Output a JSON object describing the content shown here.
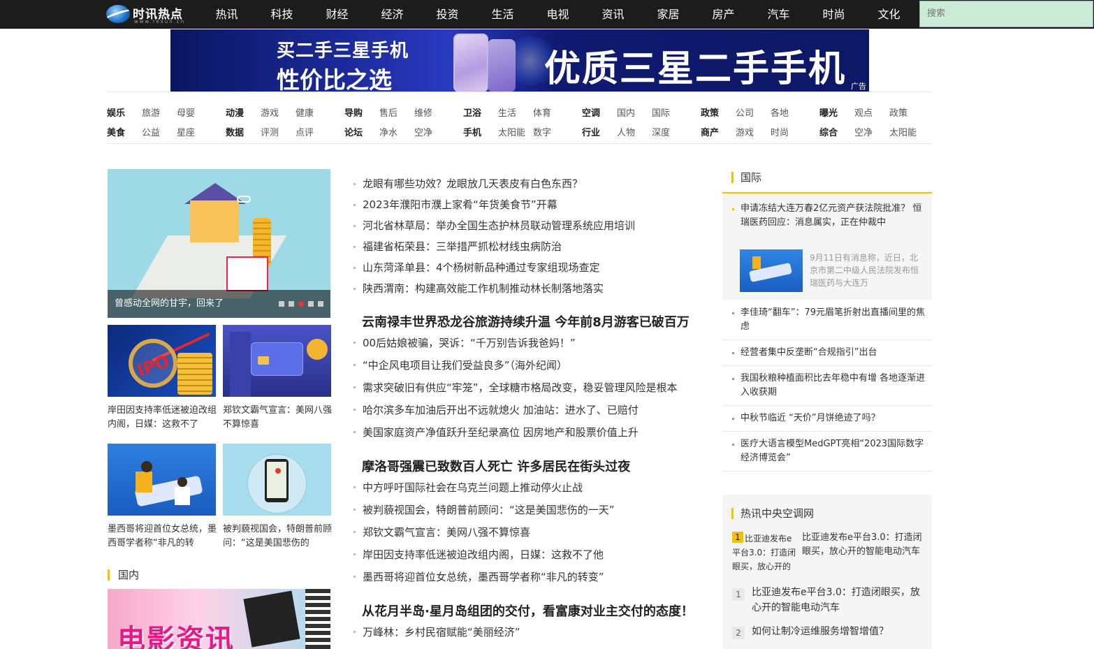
{
  "header": {
    "logo_text": "时讯热点",
    "logo_url_text": "www.rexun.cn",
    "nav": [
      "热讯",
      "科技",
      "财经",
      "经济",
      "投资",
      "生活",
      "电视",
      "资讯",
      "家居",
      "房产",
      "汽车",
      "时尚",
      "文化"
    ],
    "search_placeholder": "搜索"
  },
  "ad": {
    "line1": "买二手三星手机",
    "line2": "性价比之选",
    "headline": "优质三星二手手机",
    "tag": "广告"
  },
  "categories": [
    {
      "row1": [
        "娱乐",
        "旅游",
        "母婴"
      ],
      "row2": [
        "美食",
        "公益",
        "星座"
      ]
    },
    {
      "row1": [
        "动漫",
        "游戏",
        "健康"
      ],
      "row2": [
        "数据",
        "评测",
        "点评"
      ]
    },
    {
      "row1": [
        "导购",
        "售后",
        "维修"
      ],
      "row2": [
        "论坛",
        "净水",
        "空净"
      ]
    },
    {
      "row1": [
        "卫浴",
        "生活",
        "体育"
      ],
      "row2": [
        "手机",
        "太阳能",
        "数字"
      ]
    },
    {
      "row1": [
        "空调",
        "国内",
        "国际"
      ],
      "row2": [
        "行业",
        "人物",
        "深度"
      ]
    },
    {
      "row1": [
        "政策",
        "公司",
        "各地"
      ],
      "row2": [
        "商产",
        "游戏",
        "时尚"
      ]
    },
    {
      "row1": [
        "曝光",
        "观点",
        "政策"
      ],
      "row2": [
        "综合",
        "空净",
        "太阳能"
      ]
    }
  ],
  "left": {
    "slider_caption": "曾感动全网的甘宇，回来了",
    "thumbs": [
      {
        "caption": "岸田因支持率低迷被迫改组内阁，日媒：这救不了"
      },
      {
        "caption": "郑钦文霸气宣言：美网八强不算惊喜"
      },
      {
        "caption": "墨西哥将迎首位女总统，墨西哥学者称“非凡的转"
      },
      {
        "caption": "被判藐视国会，特朗普前顾问：“这是美国悲伤的"
      }
    ],
    "section_domestic": "国内",
    "movie_text": "电影资讯"
  },
  "center": {
    "list1": [
      "龙眼有哪些功效？龙眼放几天表皮有白色东西？",
      "2023年濮阳市濮上家肴“年货美食节”开幕",
      "河北省林草局：举办全国生态护林员联动管理系统应用培训",
      "福建省柘荣县：三举措严抓松材线虫病防治",
      "山东菏泽单县：4个杨树新品种通过专家组现场查定",
      "陕西渭南：构建高效能工作机制推动林长制落地落实"
    ],
    "headline2": "云南禄丰世界恐龙谷旅游持续升温 今年前8月游客已破百万",
    "list2": [
      "00后姑娘被骗，哭诉：“千万别告诉我爸妈！”",
      "“中企风电项目让我们受益良多”（海外纪闻）",
      "需求突破旧有供应“牢笼”，全球糖市格局改变，稳妥管理风险是根本",
      "哈尔滨多车加油后开出不远就熄火 加油站：进水了、已赔付",
      "美国家庭资产净值跃升至纪录高位 因房地产和股票价值上升"
    ],
    "headline3": "摩洛哥强震已致数百人死亡 许多居民在街头过夜",
    "list3": [
      "中方呼吁国际社会在乌克兰问题上推动停火止战",
      "被判藐视国会，特朗普前顾问：“这是美国悲伤的一天”",
      "郑钦文霸气宣言：美网八强不算惊喜",
      "岸田因支持率低迷被迫改组内阁，日媒：这救不了他",
      "墨西哥将迎首位女总统，墨西哥学者称“非凡的转变”"
    ],
    "headline4": "从花月半岛·星月岛组团的交付，看富康对业主交付的态度！",
    "list4": [
      "万峰林：乡村民宿赋能“美丽经济”"
    ]
  },
  "right": {
    "intl_title": "国际",
    "intl_first": "申请冻结大连万春2亿元资产获法院批准？ 恒瑞医药回应：消息属实，正在仲裁中",
    "intl_first_desc": "9月11日有消息称，近日，北京市第二中级人民法院发布恒瑞医药与大连万",
    "intl_items": [
      "李佳琦“翻车”：79元眉笔折射出直播间里的焦虑",
      "经营者集中反垄断“合规指引”出台",
      "我国秋粮种植面积比去年稳中有增 各地逐渐进入收获期",
      "中秋节临近 “天价”月饼绝迹了吗？",
      "医疗大语言模型MedGPT亮相“2023国际数字经济博览会”"
    ],
    "hot_title": "热讯中央空调网",
    "hot_first_rank": "1",
    "hot_first_small": "比亚迪发布e平台3.0：打造闭眼买，放心开的",
    "hot_first_title": "比亚迪发布e平台3.0：打造闭眼买，放心开的智能电动汽车",
    "hot_items": [
      {
        "rank": "1",
        "title": "比亚迪发布e平台3.0：打造闭眼买，放心开的智能电动汽车"
      },
      {
        "rank": "2",
        "title": "如何让制冷运维服务增智增值？"
      }
    ]
  },
  "colors": {
    "accent": "#f2c200",
    "topbar": "#1c1c1c",
    "search_bg": "#ccebd6"
  }
}
